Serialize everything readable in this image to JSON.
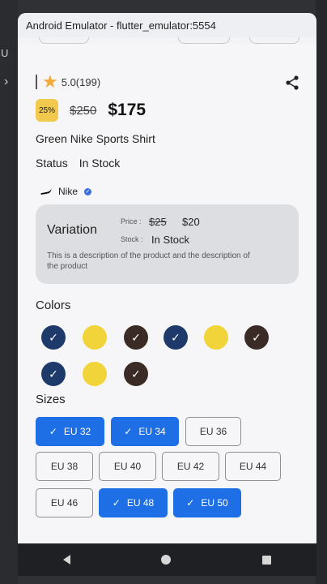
{
  "window": {
    "title": "Android Emulator - flutter_emulator:5554"
  },
  "desktop": {
    "left_letter": "U",
    "left_chevron": "›"
  },
  "product": {
    "rating": "5.0(199)",
    "discount_badge": "25%",
    "old_price": "$250",
    "new_price": "$175",
    "title": "Green Nike Sports Shirt",
    "status_label": "Status",
    "status_value": "In Stock",
    "brand": "Nike"
  },
  "variation": {
    "title": "Variation",
    "price_label": "Price :",
    "old_price": "$25",
    "new_price": "$20",
    "stock_label": "Stock :",
    "stock_value": "In Stock",
    "description": "This is a description of the product and the description of the product"
  },
  "colors": {
    "title": "Colors",
    "items": [
      {
        "name": "navy",
        "hex": "#1d3a6b",
        "selected": true
      },
      {
        "name": "yellow",
        "hex": "#f1d43a",
        "selected": false
      },
      {
        "name": "brown",
        "hex": "#3b2b27",
        "selected": true
      },
      {
        "name": "navy",
        "hex": "#1d3a6b",
        "selected": true
      },
      {
        "name": "yellow",
        "hex": "#f1d43a",
        "selected": false
      },
      {
        "name": "brown",
        "hex": "#3b2b27",
        "selected": true
      },
      {
        "name": "navy",
        "hex": "#1d3a6b",
        "selected": true
      },
      {
        "name": "yellow",
        "hex": "#f1d43a",
        "selected": false
      },
      {
        "name": "brown",
        "hex": "#3b2b27",
        "selected": true
      }
    ]
  },
  "sizes": {
    "title": "Sizes",
    "items": [
      {
        "label": "EU 32",
        "selected": true
      },
      {
        "label": "EU 34",
        "selected": true
      },
      {
        "label": "EU 36",
        "selected": false
      },
      {
        "label": "EU 38",
        "selected": false
      },
      {
        "label": "EU 40",
        "selected": false
      },
      {
        "label": "EU 42",
        "selected": false
      },
      {
        "label": "EU 44",
        "selected": false
      },
      {
        "label": "EU 46",
        "selected": false
      },
      {
        "label": "EU 48",
        "selected": true
      },
      {
        "label": "EU 50",
        "selected": true
      }
    ]
  },
  "icons": {
    "star": "star-icon",
    "share": "share-icon",
    "check": "check-icon"
  },
  "accent": "#1e6fe6"
}
